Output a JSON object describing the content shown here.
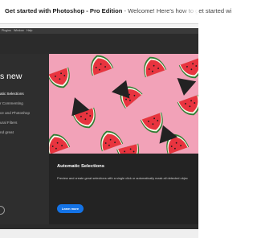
{
  "window": {
    "title_bold": "Get started with Photoshop - Pro Edition",
    "title_separator": " - ",
    "title_rest": "Welcome! Here's how to get started wi"
  },
  "menubar": {
    "items": [
      "Plugins",
      "Window",
      "Help"
    ]
  },
  "sidebar": {
    "heading": "s new",
    "items": [
      {
        "label": "atic Selections",
        "active": true
      },
      {
        "label": "r Commenting",
        "active": false
      },
      {
        "label": "ce and Photoshop",
        "active": false
      },
      {
        "label": "ural Filters",
        "active": false
      },
      {
        "label": "nd great",
        "active": false
      }
    ]
  },
  "feature": {
    "title": "Automatic Selections",
    "description": "Preview and create great selections with a single click or automatically mask all detected objec",
    "button_label": "Learn more"
  },
  "colors": {
    "accent": "#1473e6",
    "hero_background": "#f2a2b8",
    "panel": "#232323"
  }
}
